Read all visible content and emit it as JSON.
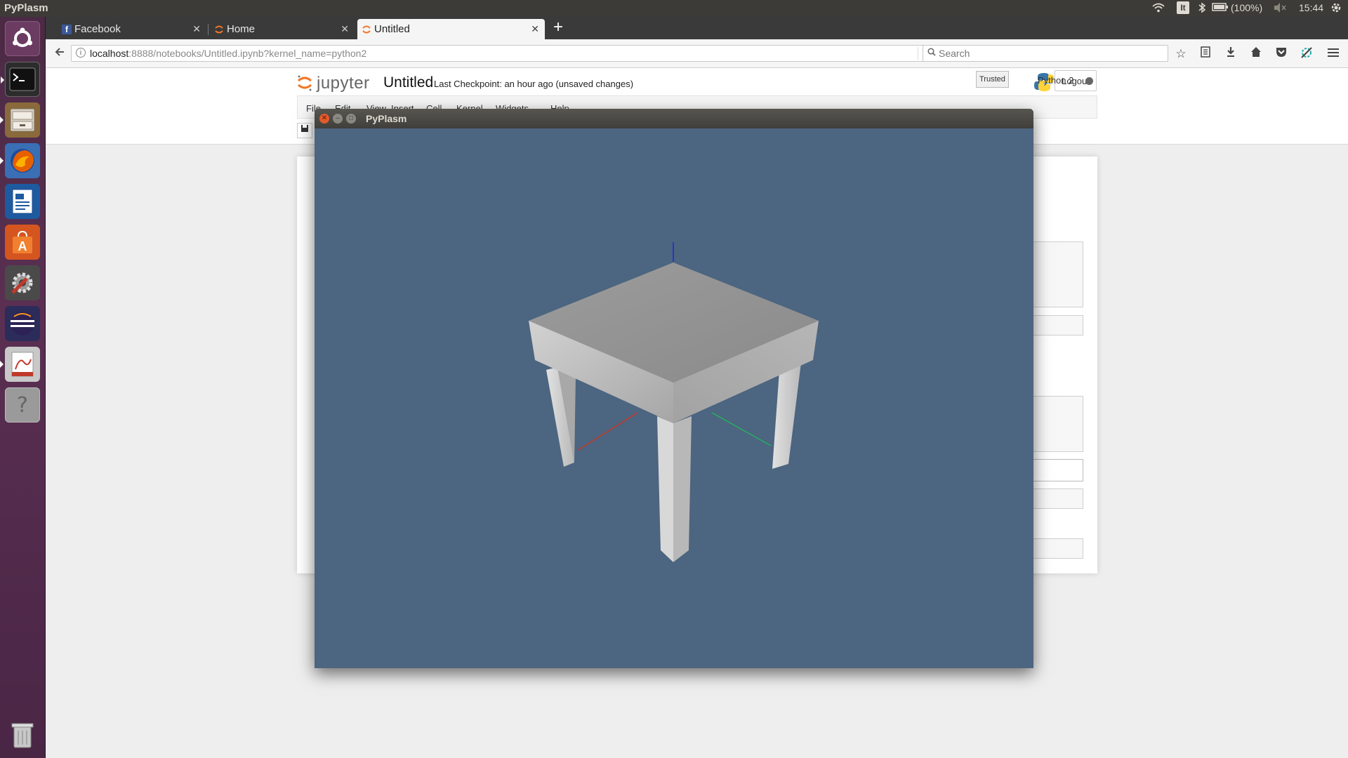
{
  "top_panel": {
    "title": "PyPlasm",
    "keyboard_layout": "It",
    "battery": "(100%)",
    "clock": "15:44"
  },
  "browser": {
    "tabs": [
      {
        "label": "Facebook",
        "active": false
      },
      {
        "label": "Home",
        "active": false
      },
      {
        "label": "Untitled",
        "active": true
      }
    ],
    "url_host": "localhost",
    "url_rest": ":8888/notebooks/Untitled.ipynb?kernel_name=python2",
    "search_placeholder": "Search"
  },
  "jupyter": {
    "logo_text": "jupyter",
    "notebook_name": "Untitled",
    "checkpoint": "Last Checkpoint: an hour ago (unsaved changes)",
    "logout_label": "Logout",
    "menu": [
      "File",
      "Edit",
      "View",
      "Insert",
      "Cell",
      "Kernel",
      "Widgets",
      "Help"
    ],
    "trusted_label": "Trusted",
    "kernel_name": "Python 2"
  },
  "pyplasm_window": {
    "title": "PyPlasm",
    "background_color": "#4c6580"
  },
  "colors": {
    "panel": "#3c3b37",
    "launcher": "#4b2a45",
    "close_button": "#e25b2b"
  }
}
